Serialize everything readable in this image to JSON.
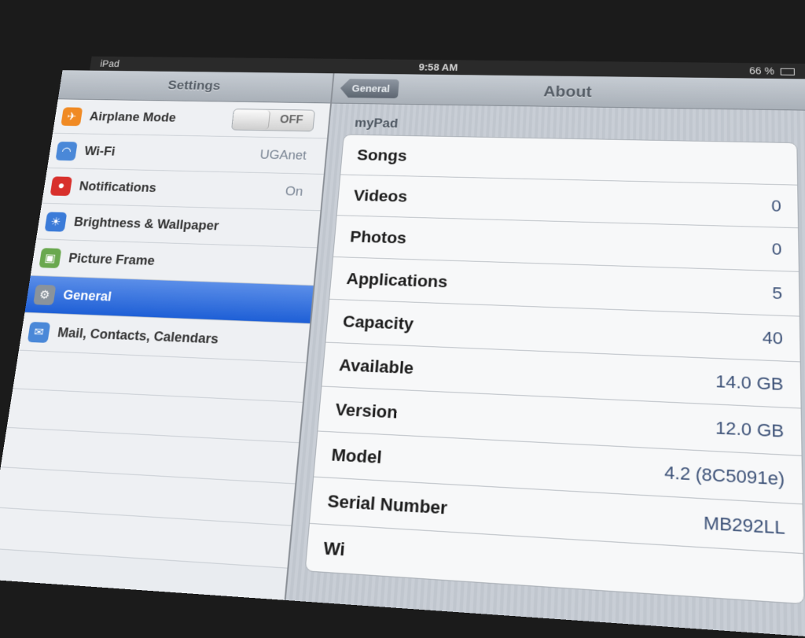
{
  "statusbar": {
    "carrier": "iPad",
    "time": "9:58 AM",
    "battery": "66 %"
  },
  "settings": {
    "title": "Settings",
    "items": [
      {
        "name": "airplane-mode",
        "label": "Airplane Mode",
        "icon": "airplane-icon",
        "icon_color": "#f08a24",
        "control": "toggle",
        "toggle_value": "OFF"
      },
      {
        "name": "wifi",
        "label": "Wi-Fi",
        "icon": "wifi-icon",
        "icon_color": "#4a88d8",
        "value": "UGAnet"
      },
      {
        "name": "notifications",
        "label": "Notifications",
        "icon": "notifications-icon",
        "icon_color": "#d8302c",
        "value": "On"
      },
      {
        "name": "brightness-wallpaper",
        "label": "Brightness & Wallpaper",
        "icon": "brightness-icon",
        "icon_color": "#3b7bd8"
      },
      {
        "name": "picture-frame",
        "label": "Picture Frame",
        "icon": "picture-frame-icon",
        "icon_color": "#6aa84f"
      },
      {
        "name": "general",
        "label": "General",
        "icon": "gear-icon",
        "icon_color": "#8a939c",
        "selected": true
      },
      {
        "name": "contacts-calendars",
        "label": "Mail, Contacts, Calendars",
        "icon": "mail-icon",
        "icon_color": "#4a88d8"
      },
      {
        "name": "empty-1",
        "label": ""
      },
      {
        "name": "empty-2",
        "label": ""
      },
      {
        "name": "empty-3",
        "label": ""
      },
      {
        "name": "empty-4",
        "label": ""
      },
      {
        "name": "empty-5",
        "label": ""
      }
    ]
  },
  "about": {
    "back_label": "General",
    "title": "About",
    "section_header": "myPad",
    "rows": [
      {
        "label": "Songs",
        "value": ""
      },
      {
        "label": "Videos",
        "value": "0"
      },
      {
        "label": "Photos",
        "value": "0"
      },
      {
        "label": "Applications",
        "value": "5"
      },
      {
        "label": "Capacity",
        "value": "40"
      },
      {
        "label": "Available",
        "value": "14.0 GB"
      },
      {
        "label": "Version",
        "value": "12.0 GB"
      },
      {
        "label": "Model",
        "value": "4.2 (8C5091e)"
      },
      {
        "label": "Serial Number",
        "value": "MB292LL"
      },
      {
        "label": "Wi",
        "value": ""
      }
    ]
  },
  "colors": {
    "selection": "#1e5fd6",
    "value_text": "#3d5278"
  }
}
